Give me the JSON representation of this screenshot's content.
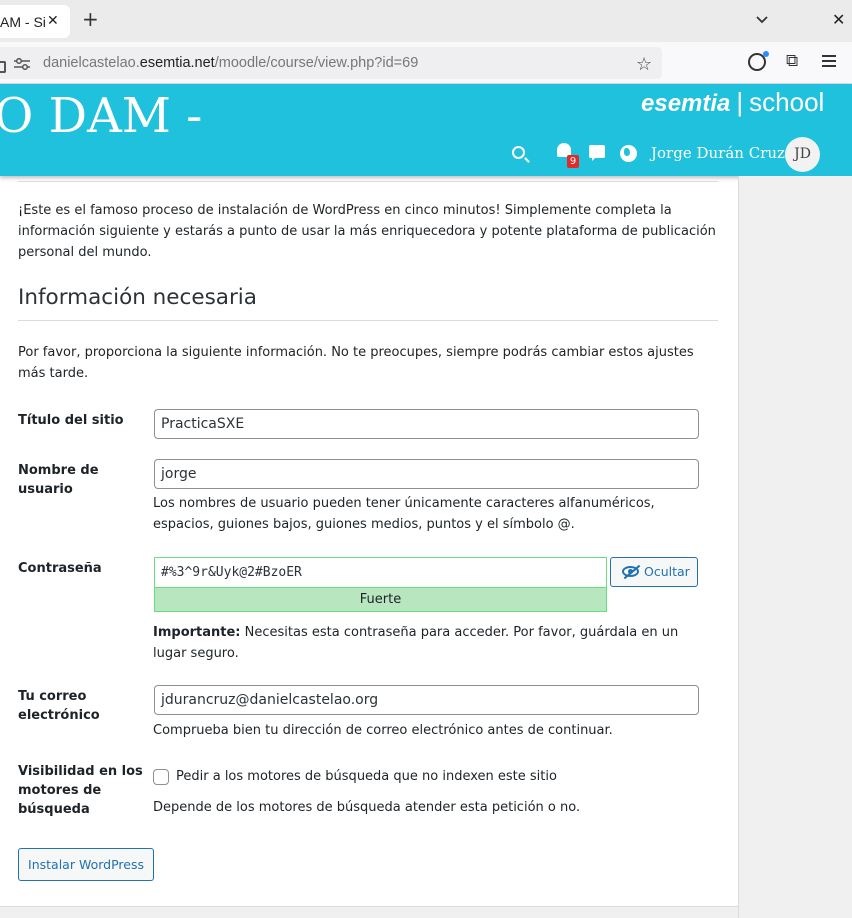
{
  "browser": {
    "tab_title": "AM - Si",
    "tab_close": "✕",
    "new_tab": "+",
    "url_host_prefix": "danielcastelao.",
    "url_host": "esemtia.net",
    "url_path": "/moodle/course/view.php?id=69",
    "window_close": "✕"
  },
  "header": {
    "course_title": "O DAM -",
    "brand_name": "esemtia",
    "brand_separator": "|",
    "brand_suffix": "school",
    "notification_count": "9",
    "user_name": "Jorge Durán Cruz",
    "avatar_initials": "JD",
    "color": "#1fc1dc"
  },
  "form": {
    "intro": "¡Este es el famoso proceso de instalación de WordPress en cinco minutos! Simplemente completa la información siguiente y estarás a punto de usar la más enriquecedora y potente plataforma de publicación personal del mundo.",
    "section_title": "Información necesaria",
    "lead": "Por favor, proporciona la siguiente información. No te preocupes, siempre podrás cambiar estos ajustes más tarde.",
    "site_title_label": "Título del sitio",
    "site_title_value": "PracticaSXE",
    "username_label": "Nombre de usuario",
    "username_value": "jorge",
    "username_desc": "Los nombres de usuario pueden tener únicamente caracteres alfanuméricos, espacios, guiones bajos, guiones medios, puntos y el símbolo @.",
    "password_label": "Contraseña",
    "password_value": "#%3^9r&Uyk@2#BzoER",
    "password_strength": "Fuerte",
    "hide_button": "Ocultar",
    "password_note_strong": "Importante:",
    "password_note": " Necesitas esta contraseña para acceder. Por favor, guárdala en un lugar seguro.",
    "email_label": "Tu correo electrónico",
    "email_value": "jdurancruz@danielcastelao.org",
    "email_desc": "Comprueba bien tu dirección de correo electrónico antes de continuar.",
    "visibility_label": "Visibilidad en los motores de búsqueda",
    "visibility_checkbox_label": "Pedir a los motores de búsqueda que no indexen este sitio",
    "visibility_checked": false,
    "visibility_desc": "Depende de los motores de búsqueda atender esta petición o no.",
    "install_button": "Instalar WordPress",
    "accent_color": "#2271b1",
    "strength_color": "#b8e6bf"
  }
}
